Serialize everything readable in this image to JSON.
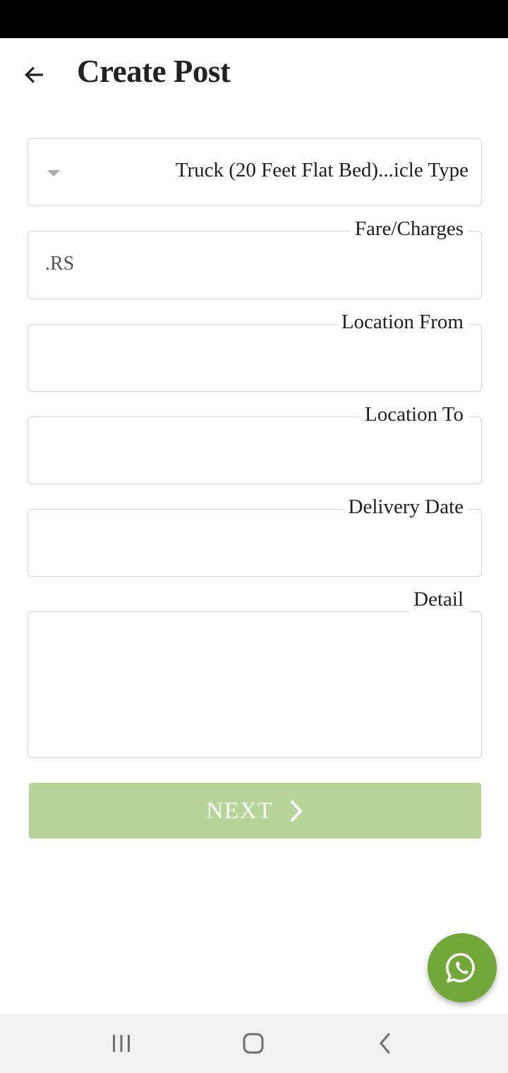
{
  "header": {
    "title": "Create Post",
    "back_icon": "arrow-left-icon"
  },
  "form": {
    "vehicle_type": {
      "value": "Truck (20 Feet Flat Bed)...icle Type",
      "icon": "caret-down-icon"
    },
    "fare": {
      "label": "Fare/Charges",
      "value": ".RS"
    },
    "location_from": {
      "label": "Location From",
      "value": ""
    },
    "location_to": {
      "label": "Location To",
      "value": ""
    },
    "delivery_date": {
      "label": "Delivery Date",
      "value": ""
    },
    "detail": {
      "label": "Detail",
      "value": ""
    }
  },
  "actions": {
    "next_label": "NEXT",
    "next_icon": "chevron-right-icon"
  },
  "fab": {
    "icon": "whatsapp-icon"
  },
  "navigation": {
    "recents_icon": "recents-icon",
    "home_icon": "home-icon",
    "back_icon": "back-icon"
  },
  "colors": {
    "accent": "#72a83a",
    "next_button": "#b7d598",
    "field_border": "#d4d4d4",
    "nav_bar": "#f1f1f1",
    "status_bar": "#000000"
  }
}
